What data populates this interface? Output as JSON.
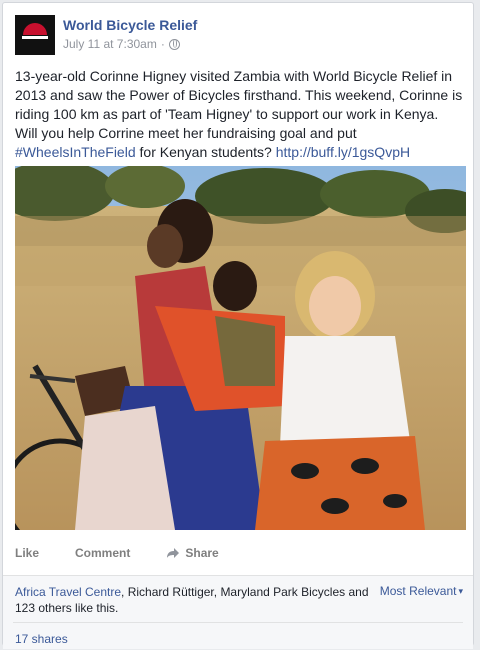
{
  "post": {
    "page_name": "World Bicycle Relief",
    "timestamp": "July 11 at 7:30am",
    "separator": "·",
    "avatar_text": "WORLD BICYCLE RELIEF",
    "text_main": "13-year-old Corinne Higney visited Zambia with World Bicycle Relief in 2013 and saw the Power of Bicycles firsthand. This weekend, Corinne is riding 100 km as part of 'Team Higney' to support our work in Kenya. Will you help Corrine meet her fundraising goal and put ",
    "hashtag": "#WheelsInTheField",
    "text_after_hashtag": " for Kenyan students? ",
    "link": "http://buff.ly/1gsQvpH"
  },
  "actions": {
    "like": "Like",
    "comment": "Comment",
    "share": "Share"
  },
  "likes": {
    "name1": "Africa Travel Centre",
    "sep1": ", ",
    "name2": "Richard Rüttiger",
    "sep2": ", ",
    "name3": "Maryland Park Bicycles",
    "tail": " and 123 others like this.",
    "sort_label": "Most Relevant",
    "sort_caret": "▾",
    "shares": "17 shares"
  },
  "colors": {
    "link": "#3b5998",
    "text": "#1d2129",
    "muted": "#90949c"
  }
}
